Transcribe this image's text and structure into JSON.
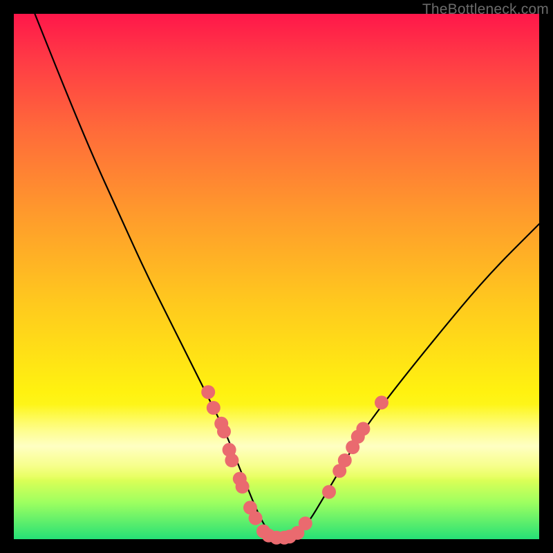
{
  "attribution": "TheBottleneck.com",
  "chart_data": {
    "type": "line",
    "title": "",
    "xlabel": "",
    "ylabel": "",
    "xlim": [
      0,
      100
    ],
    "ylim": [
      0,
      100
    ],
    "series": [
      {
        "name": "bottleneck-curve",
        "x": [
          4,
          10,
          15,
          20,
          25,
          30,
          34,
          37,
          40,
          42,
          44,
          46,
          48,
          50,
          53,
          56,
          59,
          62,
          66,
          72,
          80,
          90,
          100
        ],
        "values": [
          100,
          85,
          73,
          62,
          51,
          41,
          33,
          27,
          21,
          16,
          11,
          6,
          2,
          0,
          0,
          3,
          8,
          13,
          20,
          28,
          38,
          50,
          60
        ]
      }
    ],
    "markers": {
      "name": "highlight-dots",
      "color": "#ea6a6f",
      "radius": 10,
      "points": [
        {
          "x": 37,
          "y": 28
        },
        {
          "x": 38,
          "y": 25
        },
        {
          "x": 39.5,
          "y": 22
        },
        {
          "x": 40,
          "y": 20.5
        },
        {
          "x": 41,
          "y": 17
        },
        {
          "x": 41.5,
          "y": 15
        },
        {
          "x": 43,
          "y": 11.5
        },
        {
          "x": 43.5,
          "y": 10
        },
        {
          "x": 45,
          "y": 6
        },
        {
          "x": 46,
          "y": 4
        },
        {
          "x": 47.5,
          "y": 1.5
        },
        {
          "x": 48.5,
          "y": 0.7
        },
        {
          "x": 50,
          "y": 0.3
        },
        {
          "x": 51.5,
          "y": 0.3
        },
        {
          "x": 52.5,
          "y": 0.5
        },
        {
          "x": 54,
          "y": 1.2
        },
        {
          "x": 55.5,
          "y": 3
        },
        {
          "x": 60,
          "y": 9
        },
        {
          "x": 62,
          "y": 13
        },
        {
          "x": 63,
          "y": 15
        },
        {
          "x": 64.5,
          "y": 17.5
        },
        {
          "x": 65.5,
          "y": 19.5
        },
        {
          "x": 66.5,
          "y": 21
        },
        {
          "x": 70,
          "y": 26
        }
      ]
    },
    "gradient_stops": [
      {
        "pos": 0.0,
        "color": "#ff174a"
      },
      {
        "pos": 0.08,
        "color": "#ff3846"
      },
      {
        "pos": 0.22,
        "color": "#ff6a3a"
      },
      {
        "pos": 0.38,
        "color": "#ff9a2c"
      },
      {
        "pos": 0.55,
        "color": "#ffc91e"
      },
      {
        "pos": 0.72,
        "color": "#fff210"
      },
      {
        "pos": 0.82,
        "color": "#fbff35"
      },
      {
        "pos": 0.88,
        "color": "#e6ff55"
      },
      {
        "pos": 0.93,
        "color": "#9eff60"
      },
      {
        "pos": 1.0,
        "color": "#25e076"
      }
    ]
  }
}
